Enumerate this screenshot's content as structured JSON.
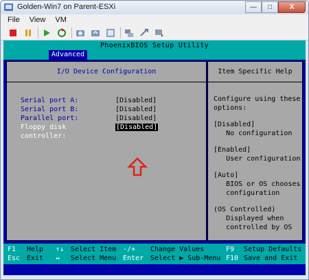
{
  "window": {
    "title": "Golden-Win7 on Parent-ESXi",
    "controls": {
      "minimize": "—",
      "maximize": "□",
      "close": "X"
    }
  },
  "menubar": {
    "items": [
      "File",
      "View",
      "VM"
    ]
  },
  "toolbar": {
    "icons": [
      "stop-icon",
      "pause-icon",
      "play-icon",
      "reset-icon",
      "snapshot-icon",
      "revert-snapshot-icon",
      "manage-snapshots-icon",
      "network-icon",
      "usb-icon",
      "console-settings-icon"
    ]
  },
  "bios": {
    "title": "PhoenixBIOS Setup Utility",
    "active_tab": "Advanced",
    "section_title": "I/O Device Configuration",
    "help_title": "Item Specific Help",
    "settings": [
      {
        "label": "Serial port A:",
        "value": "[Disabled]"
      },
      {
        "label": "Serial port B:",
        "value": "[Disabled]"
      },
      {
        "label": "Parallel port:",
        "value": "[Disabled]"
      },
      {
        "label": "Floppy disk controller:",
        "value": "[Disabled]",
        "selected": true
      }
    ],
    "help": [
      "Configure using these\noptions:",
      "[Disabled]\n   No configuration",
      "[Enabled]\n   User configuration",
      "[Auto]\n   BIOS or OS chooses\n   configuration",
      "(OS Controlled)\n   Displayed when\n   controlled by OS"
    ],
    "footer": {
      "row1": {
        "k1": "F1",
        "d1": "Help",
        "k2": "↑↓",
        "d2": "Select Item",
        "k3": "-/+",
        "d3": "Change Values",
        "k4": "F9",
        "d4": "Setup Defaults"
      },
      "row2": {
        "k1": "Esc",
        "d1": "Exit",
        "k2": "↔",
        "d2": "Select Menu",
        "k3": "Enter",
        "d3": "Select ▶ Sub-Menu",
        "k4": "F10",
        "d4": "Save and Exit"
      }
    },
    "colors": {
      "blue": "#0000a8",
      "cyan": "#00a8a8",
      "gray": "#a8a8a8",
      "arrow": "#e0201a"
    }
  }
}
